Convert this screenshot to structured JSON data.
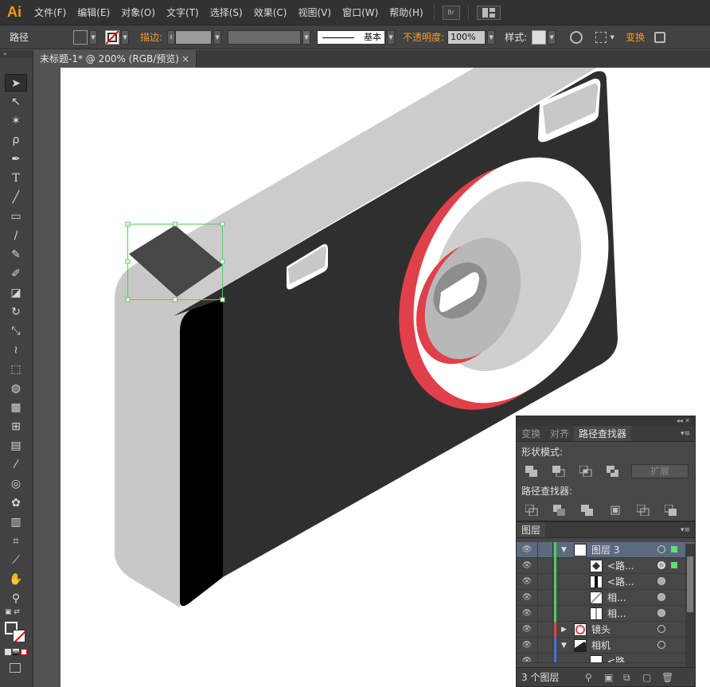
{
  "app": {
    "logo": "Ai"
  },
  "menu": [
    "文件(F)",
    "编辑(E)",
    "对象(O)",
    "文字(T)",
    "选择(S)",
    "效果(C)",
    "视图(V)",
    "窗口(W)",
    "帮助(H)"
  ],
  "menu_br": "Br",
  "control": {
    "object_type": "路径",
    "stroke_label": "描边:",
    "stroke_style": "基本",
    "opacity_label": "不透明度:",
    "opacity_value": "100%",
    "style_label": "样式:",
    "transform_label": "变换"
  },
  "document": {
    "tab_title": "未标题-1* @ 200% (RGB/预览)",
    "close": "×"
  },
  "pathfinder": {
    "tabs": [
      "变换",
      "对齐",
      "路径查找器"
    ],
    "shape_modes_label": "形状模式:",
    "expand_label": "扩展",
    "pathfinders_label": "路径查找器:"
  },
  "layers": {
    "tab": "图层",
    "rows": [
      {
        "name": "图层 3",
        "color": "#4dd15c"
      },
      {
        "name": "<路...",
        "color": "#4dd15c"
      },
      {
        "name": "<路...",
        "color": "#4dd15c"
      },
      {
        "name": "相...",
        "color": "#4dd15c"
      },
      {
        "name": "相...",
        "color": "#4dd15c"
      },
      {
        "name": "镜头",
        "color": "#e0404a"
      },
      {
        "name": "相机",
        "color": "#4a6ee0"
      },
      {
        "name": "<路...",
        "color": "#4a6ee0"
      }
    ],
    "footer": "3 个图层"
  },
  "colors": {
    "camera_body": "#2f2f2f",
    "camera_top": "#cccccc",
    "camera_side": "#c8c8c8",
    "lens_red": "#e0404a",
    "selection_green": "#4dd15c",
    "accent_orange": "#f29a2e"
  }
}
